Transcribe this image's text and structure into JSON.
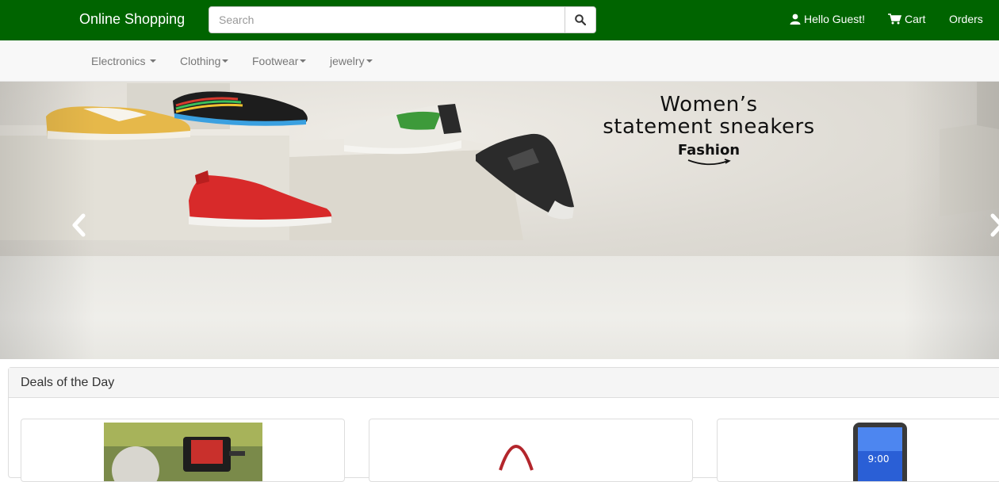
{
  "header": {
    "brand": "Online Shopping",
    "search_placeholder": "Search",
    "hello_label": "Hello Guest!",
    "cart_label": "Cart",
    "orders_label": "Orders",
    "bg_color": "#006400"
  },
  "categories": [
    {
      "label": "Electronics"
    },
    {
      "label": "Clothing"
    },
    {
      "label": "Footwear"
    },
    {
      "label": "jewelry"
    }
  ],
  "banner": {
    "line1": "Women’s",
    "line2": "statement sneakers",
    "line3": "Fashion"
  },
  "deals": {
    "title": "Deals of the Day",
    "items": [
      {
        "icon": "camera-product-image"
      },
      {
        "icon": "handbag-product-image"
      },
      {
        "icon": "smartphone-product-image"
      }
    ]
  }
}
